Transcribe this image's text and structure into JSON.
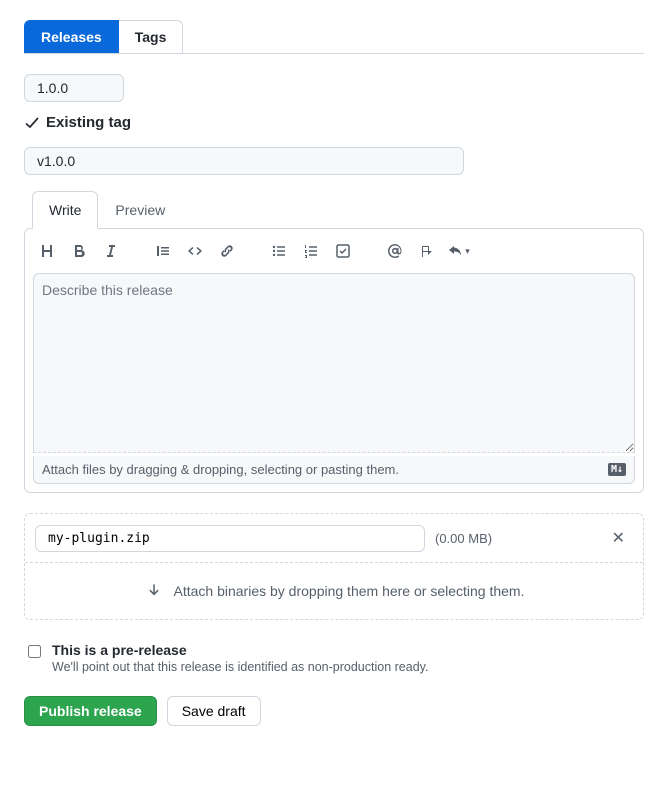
{
  "topTabs": {
    "releases": "Releases",
    "tags": "Tags"
  },
  "tagSelector": "1.0.0",
  "existingTag": "Existing tag",
  "titleInput": "v1.0.0",
  "editorTabs": {
    "write": "Write",
    "preview": "Preview"
  },
  "descPlaceholder": "Describe this release",
  "attachHint": "Attach files by dragging & dropping, selecting or pasting them.",
  "mdBadge": "M↓",
  "binary": {
    "filename": "my-plugin.zip",
    "size": "(0.00 MB)",
    "dropHint": "Attach binaries by dropping them here or selecting them."
  },
  "prerelease": {
    "label": "This is a pre-release",
    "desc": "We'll point out that this release is identified as non-production ready."
  },
  "actions": {
    "publish": "Publish release",
    "draft": "Save draft"
  }
}
